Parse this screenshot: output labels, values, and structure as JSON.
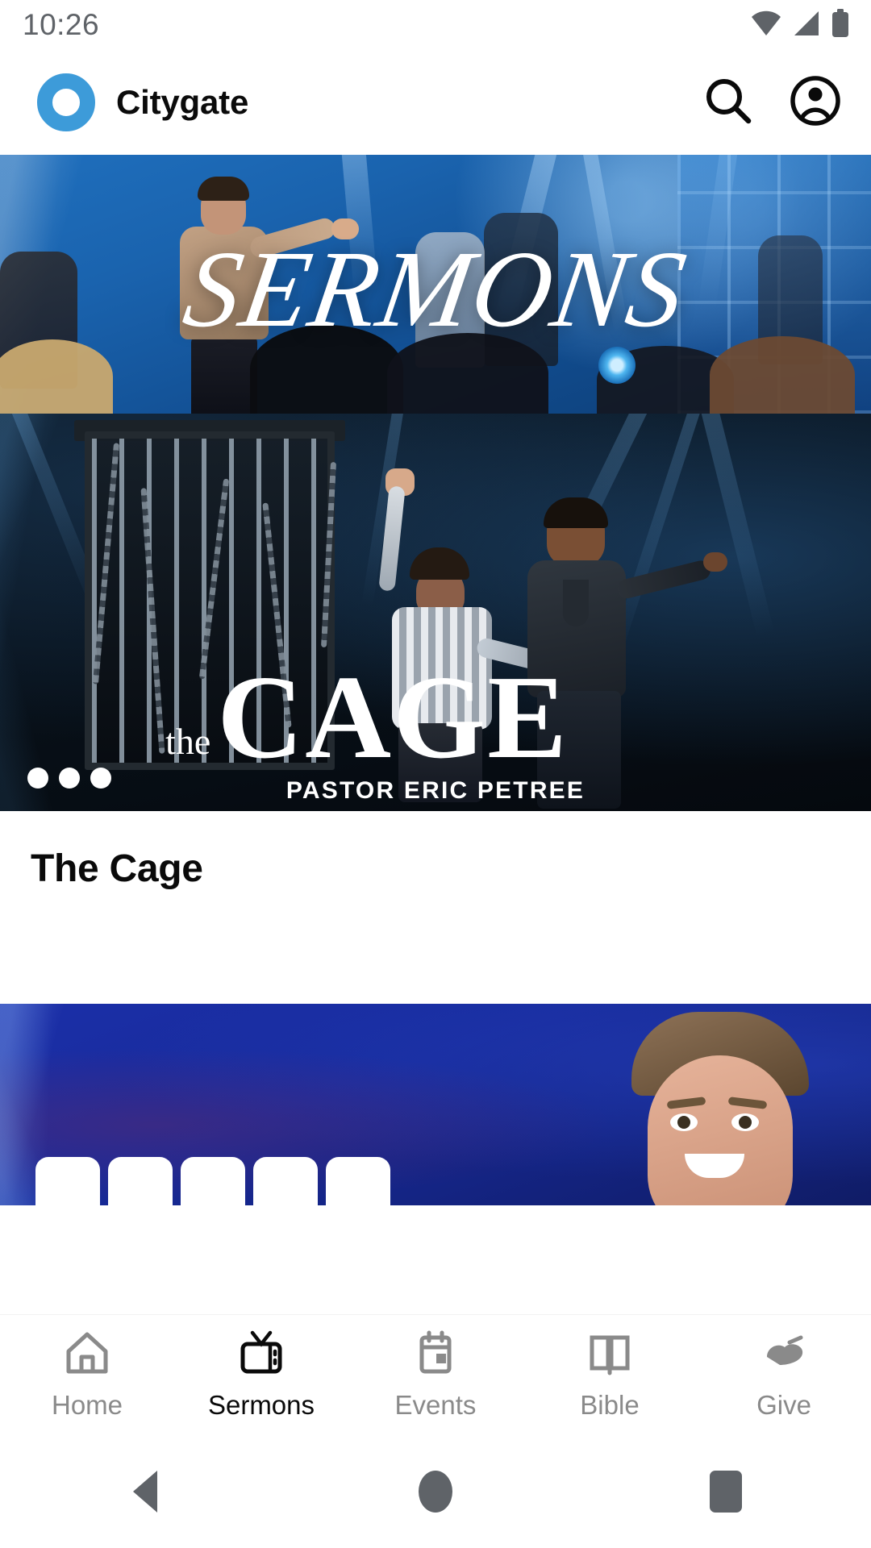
{
  "status_bar": {
    "time": "10:26",
    "icons": [
      "wifi-icon",
      "cellular-signal-icon",
      "battery-icon"
    ]
  },
  "app_bar": {
    "logo": "citygate-ring-logo",
    "brand_name": "Citygate",
    "brand_color": "#3d9bd9",
    "actions": [
      {
        "name": "search-icon",
        "label": "Search"
      },
      {
        "name": "account-icon",
        "label": "Account"
      }
    ]
  },
  "carousel": {
    "dots_total": 3,
    "dots_active": 3,
    "slides": [
      {
        "name": "sermons-hero",
        "overlay_text": "SERMONS"
      },
      {
        "name": "the-cage-hero",
        "title_small": "the",
        "title_large": "CAGE",
        "subtitle": "PASTOR ERIC PETREE"
      }
    ]
  },
  "cards": [
    {
      "title": "The Cage"
    },
    {
      "title": ""
    }
  ],
  "bottom_nav": {
    "active": "Sermons",
    "items": [
      {
        "label": "Home",
        "icon": "home-icon",
        "active": false
      },
      {
        "label": "Sermons",
        "icon": "tv-icon",
        "active": true
      },
      {
        "label": "Events",
        "icon": "calendar-icon",
        "active": false
      },
      {
        "label": "Bible",
        "icon": "book-icon",
        "active": false
      },
      {
        "label": "Give",
        "icon": "hand-heart-icon",
        "active": false
      }
    ]
  },
  "system_nav": {
    "items": [
      {
        "label": "Back",
        "icon": "back-triangle-icon"
      },
      {
        "label": "Home",
        "icon": "home-circle-icon"
      },
      {
        "label": "Recents",
        "icon": "recents-square-icon"
      }
    ]
  },
  "colors": {
    "accent": "#3d9bd9",
    "text_primary": "#0a0a0a",
    "text_muted": "#8a8a8a",
    "background": "#ffffff"
  }
}
